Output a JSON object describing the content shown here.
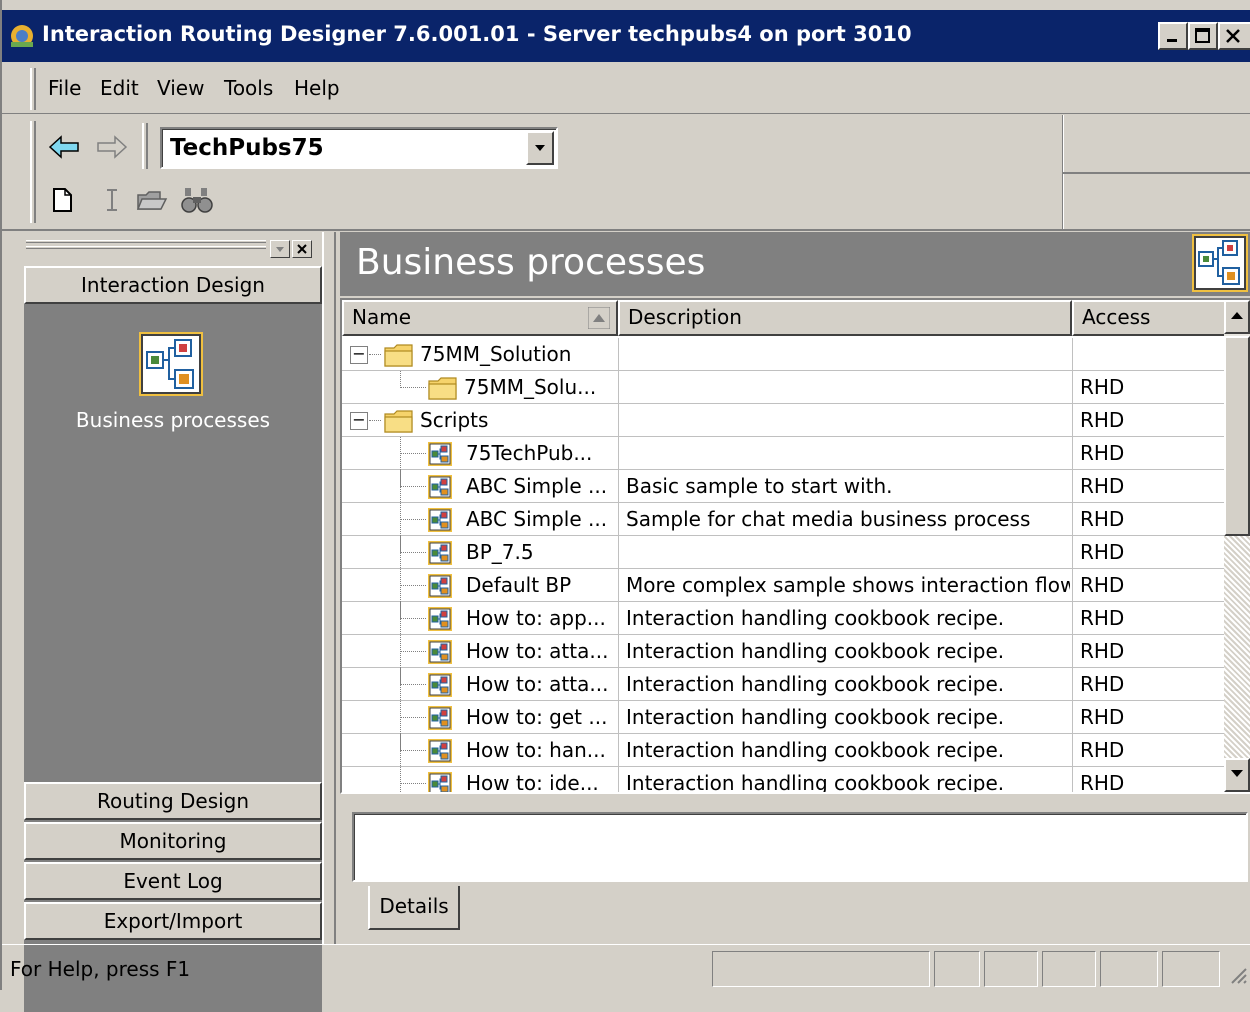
{
  "window": {
    "title": "Interaction Routing Designer  7.6.001.01  - Server techpubs4 on port 3010"
  },
  "menu": {
    "items": [
      {
        "label": "File",
        "hotkey": "F"
      },
      {
        "label": "Edit",
        "hotkey": "E"
      },
      {
        "label": "View",
        "hotkey": "V"
      },
      {
        "label": "Tools",
        "hotkey": "T"
      },
      {
        "label": "Help",
        "hotkey": "H"
      }
    ]
  },
  "toolbar": {
    "tenant_value": "TechPubs75",
    "icons": [
      "back-arrow-icon",
      "forward-arrow-icon",
      "new-document-icon",
      "text-cursor-icon",
      "open-folder-icon",
      "binoculars-icon"
    ]
  },
  "left_pane": {
    "groups": [
      "Interaction Design",
      "Routing Design",
      "Monitoring",
      "Event Log",
      "Export/Import"
    ],
    "active_group": "Interaction Design",
    "active_item_label": "Business processes"
  },
  "right_pane": {
    "header_title": "Business processes",
    "columns": [
      "Name",
      "Description",
      "Access"
    ],
    "rows": [
      {
        "name": "75MM_Solution",
        "description": "",
        "access": "",
        "level": 0,
        "type": "folder",
        "expander": "⊟"
      },
      {
        "name": "75MM_Solu...",
        "description": "",
        "access": "RHD",
        "level": 1,
        "type": "folder",
        "expander": ""
      },
      {
        "name": "Scripts",
        "description": "",
        "access": "RHD",
        "level": 0,
        "type": "folder",
        "expander": "⊟"
      },
      {
        "name": "75TechPub...",
        "description": "",
        "access": "RHD",
        "level": 1,
        "type": "bp",
        "expander": ""
      },
      {
        "name": "ABC Simple ...",
        "description": "Basic sample to start with.",
        "access": "RHD",
        "level": 1,
        "type": "bp",
        "expander": ""
      },
      {
        "name": "ABC Simple ...",
        "description": "Sample for chat media business process",
        "access": "RHD",
        "level": 1,
        "type": "bp",
        "expander": ""
      },
      {
        "name": "BP_7.5",
        "description": "",
        "access": "RHD",
        "level": 1,
        "type": "bp",
        "expander": ""
      },
      {
        "name": "Default BP",
        "description": "More complex sample shows interaction flow.",
        "access": "RHD",
        "level": 1,
        "type": "bp",
        "expander": ""
      },
      {
        "name": "How to: app...",
        "description": "Interaction handling cookbook recipe.",
        "access": "RHD",
        "level": 1,
        "type": "bp",
        "expander": ""
      },
      {
        "name": "How to: atta...",
        "description": "Interaction handling cookbook recipe.",
        "access": "RHD",
        "level": 1,
        "type": "bp",
        "expander": ""
      },
      {
        "name": "How to: atta...",
        "description": "Interaction handling cookbook recipe.",
        "access": "RHD",
        "level": 1,
        "type": "bp",
        "expander": ""
      },
      {
        "name": "How to: get ...",
        "description": "Interaction handling cookbook recipe.",
        "access": "RHD",
        "level": 1,
        "type": "bp",
        "expander": ""
      },
      {
        "name": "How to: han...",
        "description": "Interaction handling cookbook recipe.",
        "access": "RHD",
        "level": 1,
        "type": "bp",
        "expander": ""
      },
      {
        "name": "How to: ide...",
        "description": "Interaction handling cookbook recipe.",
        "access": "RHD",
        "level": 1,
        "type": "bp",
        "expander": ""
      }
    ],
    "details_tab": "Details"
  },
  "status": {
    "text": "For Help, press F1"
  }
}
